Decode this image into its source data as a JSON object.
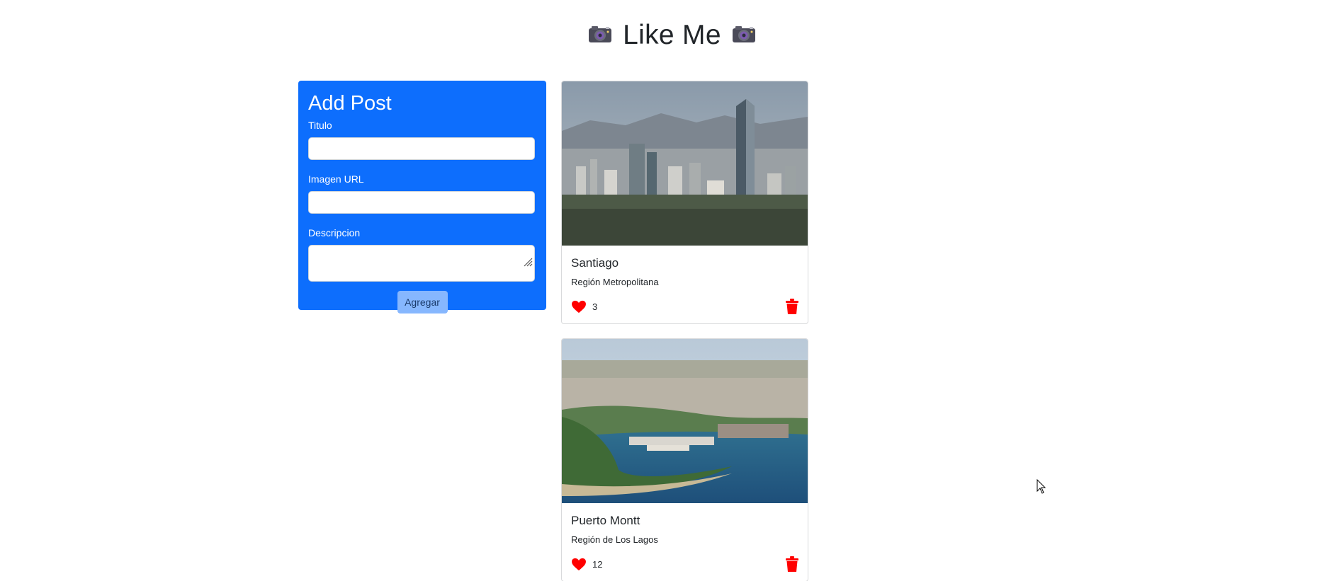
{
  "header": {
    "title": "Like Me",
    "icon_left": "camera-icon",
    "icon_right": "camera-icon"
  },
  "form": {
    "title": "Add Post",
    "title_label": "Titulo",
    "title_value": "",
    "image_label": "Imagen URL",
    "image_value": "",
    "description_label": "Descripcion",
    "description_value": "",
    "submit_label": "Agregar"
  },
  "posts": [
    {
      "title": "Santiago",
      "description": "Región Metropolitana",
      "likes": "3",
      "image": "city-skyline-photo"
    },
    {
      "title": "Puerto Montt",
      "description": "Región de Los Lagos",
      "likes": "12",
      "image": "coastal-aerial-photo"
    }
  ],
  "colors": {
    "primary": "#0d6efd",
    "button_disabled": "#86b7fe",
    "heart": "#ff0000",
    "trash": "#ff0000"
  }
}
